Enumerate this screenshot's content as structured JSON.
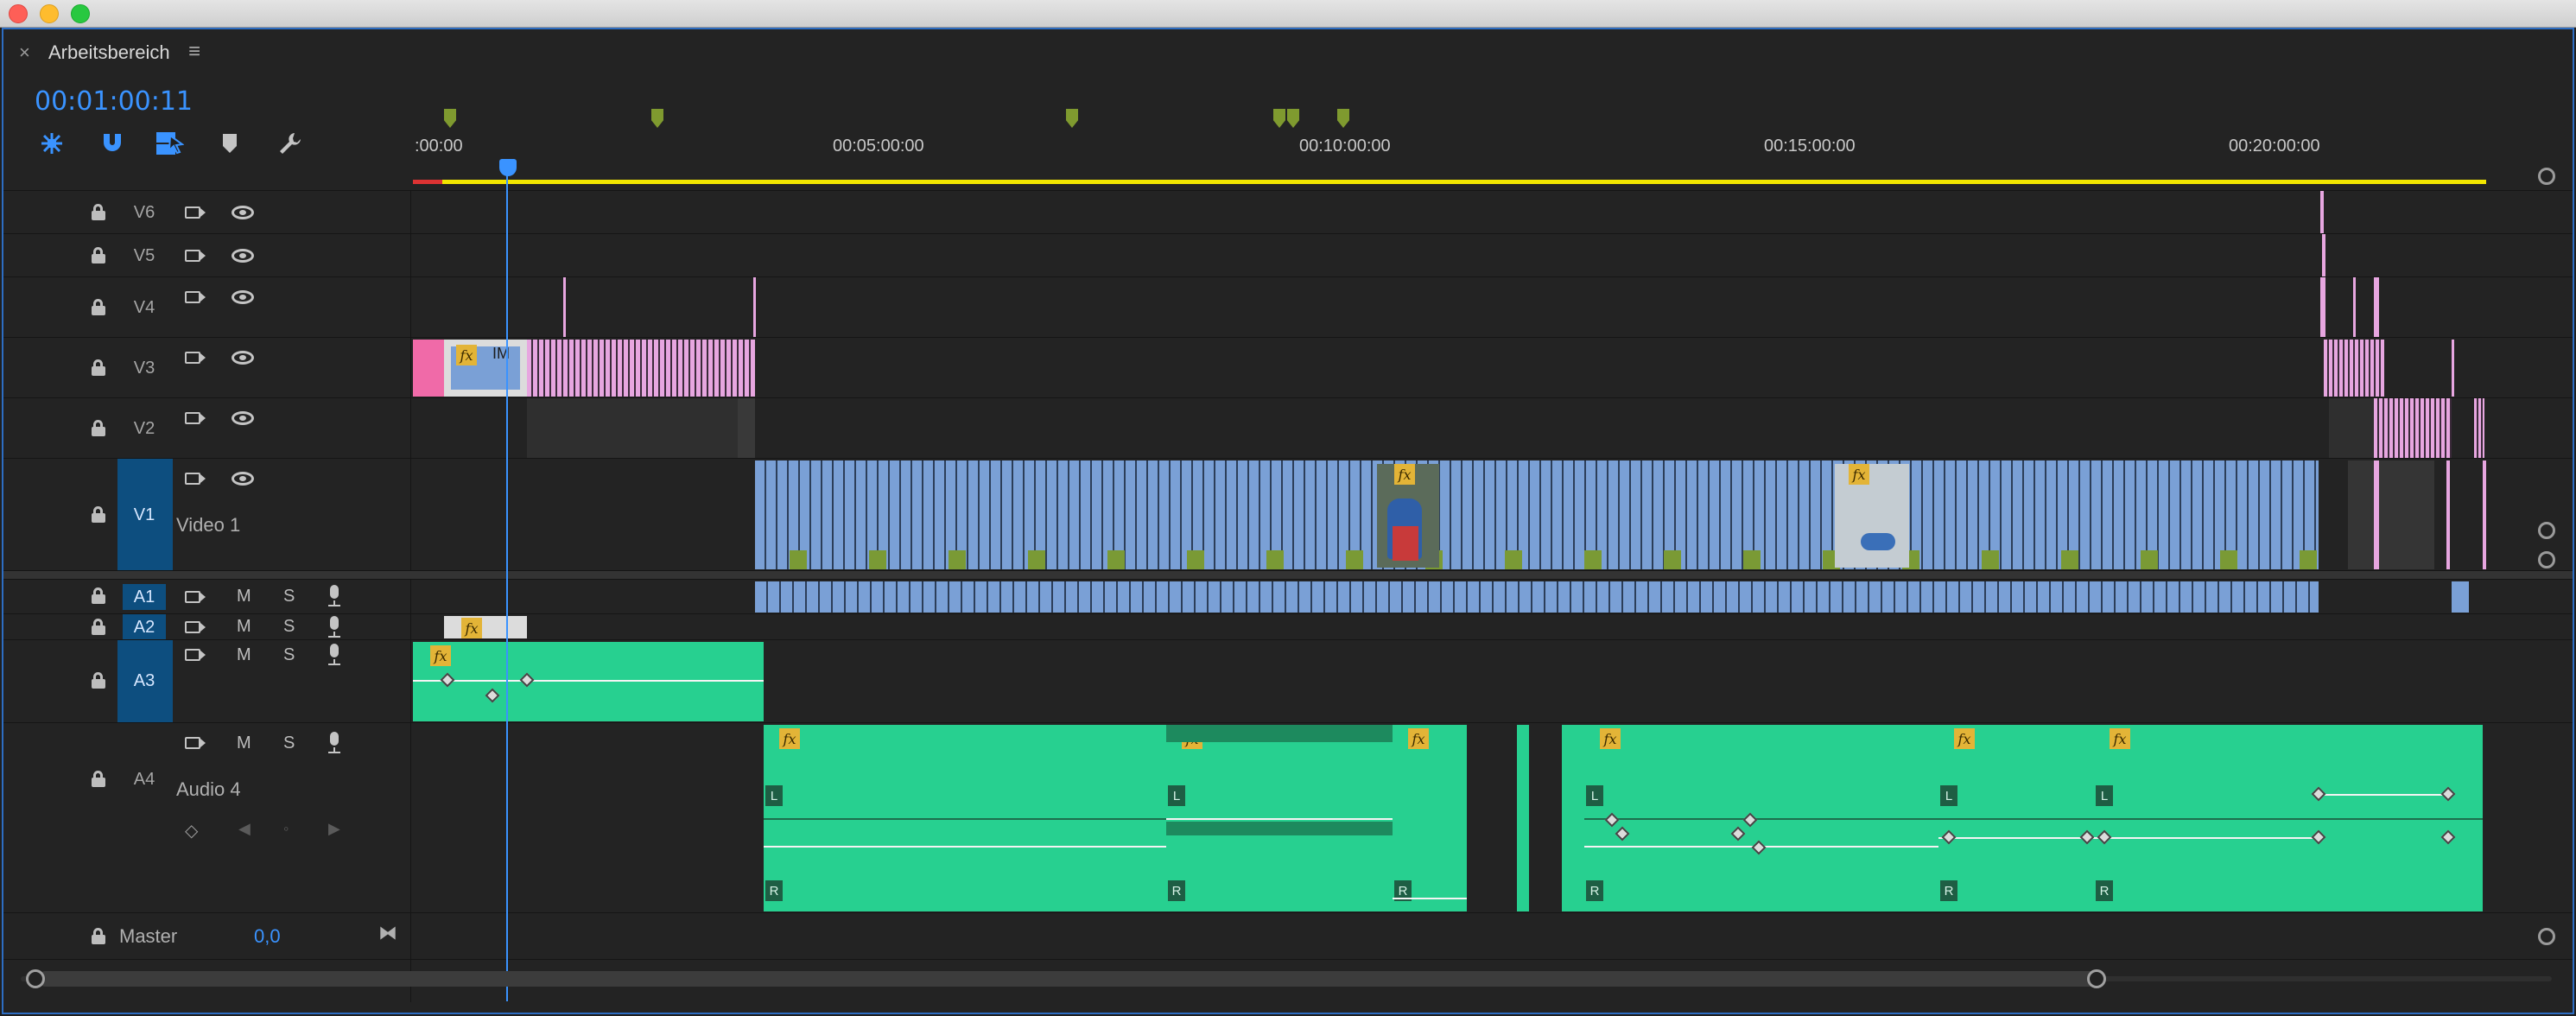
{
  "window": {
    "title_bar": ""
  },
  "panel": {
    "title": "Arbeitsbereich",
    "close_glyph": "×",
    "menu_glyph": "≡",
    "timecode": "00:01:00:11"
  },
  "toolbar": {
    "icons": [
      "nest-sequence-icon",
      "snap-magnet-icon",
      "linked-selection-icon",
      "add-marker-icon",
      "settings-wrench-icon"
    ]
  },
  "ruler": {
    "labels": [
      ":00:00",
      "00:05:00:00",
      "00:10:00:00",
      "00:15:00:00",
      "00:20:00:00"
    ]
  },
  "tracks": {
    "video": [
      {
        "name": "V6"
      },
      {
        "name": "V5"
      },
      {
        "name": "V4"
      },
      {
        "name": "V3"
      },
      {
        "name": "V2"
      },
      {
        "name": "V1",
        "label": "Video 1"
      }
    ],
    "audio": [
      {
        "name": "A1",
        "m": "M",
        "s": "S"
      },
      {
        "name": "A2",
        "m": "M",
        "s": "S"
      },
      {
        "name": "A3",
        "m": "M",
        "s": "S"
      },
      {
        "name": "A4",
        "label": "Audio 4",
        "m": "M",
        "s": "S"
      }
    ],
    "master": {
      "name": "Master",
      "value": "0,0"
    }
  },
  "clips": {
    "fx_label": "fx",
    "v3_clip_label": "IM",
    "channel_left": "L",
    "channel_right": "R"
  },
  "colors": {
    "accent": "#3a93ff",
    "video_clip": "#7aa0d6",
    "audio_clip": "#27d090",
    "pink_clip": "#e7a6e0",
    "work_area": "#f2e600",
    "track_target": "#0d4e7f"
  }
}
